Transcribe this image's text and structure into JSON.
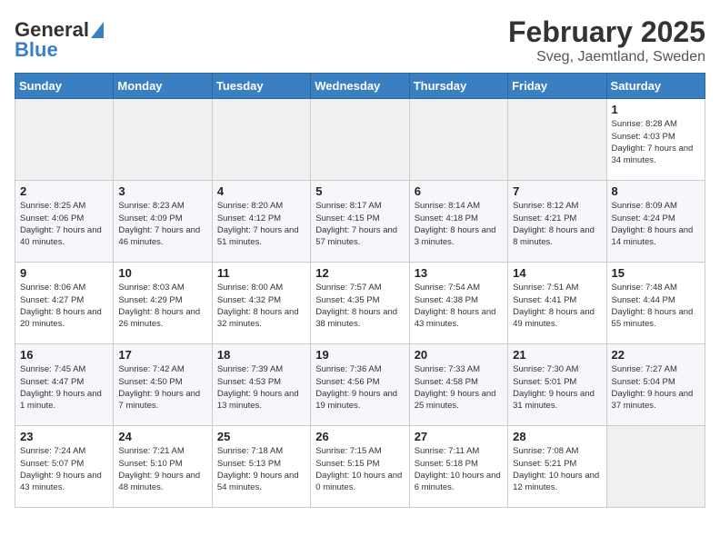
{
  "logo": {
    "general": "General",
    "blue": "Blue"
  },
  "title": {
    "month": "February 2025",
    "location": "Sveg, Jaemtland, Sweden"
  },
  "calendar": {
    "headers": [
      "Sunday",
      "Monday",
      "Tuesday",
      "Wednesday",
      "Thursday",
      "Friday",
      "Saturday"
    ],
    "weeks": [
      [
        {
          "day": "",
          "info": ""
        },
        {
          "day": "",
          "info": ""
        },
        {
          "day": "",
          "info": ""
        },
        {
          "day": "",
          "info": ""
        },
        {
          "day": "",
          "info": ""
        },
        {
          "day": "",
          "info": ""
        },
        {
          "day": "1",
          "info": "Sunrise: 8:28 AM\nSunset: 4:03 PM\nDaylight: 7 hours and 34 minutes."
        }
      ],
      [
        {
          "day": "2",
          "info": "Sunrise: 8:25 AM\nSunset: 4:06 PM\nDaylight: 7 hours and 40 minutes."
        },
        {
          "day": "3",
          "info": "Sunrise: 8:23 AM\nSunset: 4:09 PM\nDaylight: 7 hours and 46 minutes."
        },
        {
          "day": "4",
          "info": "Sunrise: 8:20 AM\nSunset: 4:12 PM\nDaylight: 7 hours and 51 minutes."
        },
        {
          "day": "5",
          "info": "Sunrise: 8:17 AM\nSunset: 4:15 PM\nDaylight: 7 hours and 57 minutes."
        },
        {
          "day": "6",
          "info": "Sunrise: 8:14 AM\nSunset: 4:18 PM\nDaylight: 8 hours and 3 minutes."
        },
        {
          "day": "7",
          "info": "Sunrise: 8:12 AM\nSunset: 4:21 PM\nDaylight: 8 hours and 8 minutes."
        },
        {
          "day": "8",
          "info": "Sunrise: 8:09 AM\nSunset: 4:24 PM\nDaylight: 8 hours and 14 minutes."
        }
      ],
      [
        {
          "day": "9",
          "info": "Sunrise: 8:06 AM\nSunset: 4:27 PM\nDaylight: 8 hours and 20 minutes."
        },
        {
          "day": "10",
          "info": "Sunrise: 8:03 AM\nSunset: 4:29 PM\nDaylight: 8 hours and 26 minutes."
        },
        {
          "day": "11",
          "info": "Sunrise: 8:00 AM\nSunset: 4:32 PM\nDaylight: 8 hours and 32 minutes."
        },
        {
          "day": "12",
          "info": "Sunrise: 7:57 AM\nSunset: 4:35 PM\nDaylight: 8 hours and 38 minutes."
        },
        {
          "day": "13",
          "info": "Sunrise: 7:54 AM\nSunset: 4:38 PM\nDaylight: 8 hours and 43 minutes."
        },
        {
          "day": "14",
          "info": "Sunrise: 7:51 AM\nSunset: 4:41 PM\nDaylight: 8 hours and 49 minutes."
        },
        {
          "day": "15",
          "info": "Sunrise: 7:48 AM\nSunset: 4:44 PM\nDaylight: 8 hours and 55 minutes."
        }
      ],
      [
        {
          "day": "16",
          "info": "Sunrise: 7:45 AM\nSunset: 4:47 PM\nDaylight: 9 hours and 1 minute."
        },
        {
          "day": "17",
          "info": "Sunrise: 7:42 AM\nSunset: 4:50 PM\nDaylight: 9 hours and 7 minutes."
        },
        {
          "day": "18",
          "info": "Sunrise: 7:39 AM\nSunset: 4:53 PM\nDaylight: 9 hours and 13 minutes."
        },
        {
          "day": "19",
          "info": "Sunrise: 7:36 AM\nSunset: 4:56 PM\nDaylight: 9 hours and 19 minutes."
        },
        {
          "day": "20",
          "info": "Sunrise: 7:33 AM\nSunset: 4:58 PM\nDaylight: 9 hours and 25 minutes."
        },
        {
          "day": "21",
          "info": "Sunrise: 7:30 AM\nSunset: 5:01 PM\nDaylight: 9 hours and 31 minutes."
        },
        {
          "day": "22",
          "info": "Sunrise: 7:27 AM\nSunset: 5:04 PM\nDaylight: 9 hours and 37 minutes."
        }
      ],
      [
        {
          "day": "23",
          "info": "Sunrise: 7:24 AM\nSunset: 5:07 PM\nDaylight: 9 hours and 43 minutes."
        },
        {
          "day": "24",
          "info": "Sunrise: 7:21 AM\nSunset: 5:10 PM\nDaylight: 9 hours and 48 minutes."
        },
        {
          "day": "25",
          "info": "Sunrise: 7:18 AM\nSunset: 5:13 PM\nDaylight: 9 hours and 54 minutes."
        },
        {
          "day": "26",
          "info": "Sunrise: 7:15 AM\nSunset: 5:15 PM\nDaylight: 10 hours and 0 minutes."
        },
        {
          "day": "27",
          "info": "Sunrise: 7:11 AM\nSunset: 5:18 PM\nDaylight: 10 hours and 6 minutes."
        },
        {
          "day": "28",
          "info": "Sunrise: 7:08 AM\nSunset: 5:21 PM\nDaylight: 10 hours and 12 minutes."
        },
        {
          "day": "",
          "info": ""
        }
      ]
    ]
  }
}
